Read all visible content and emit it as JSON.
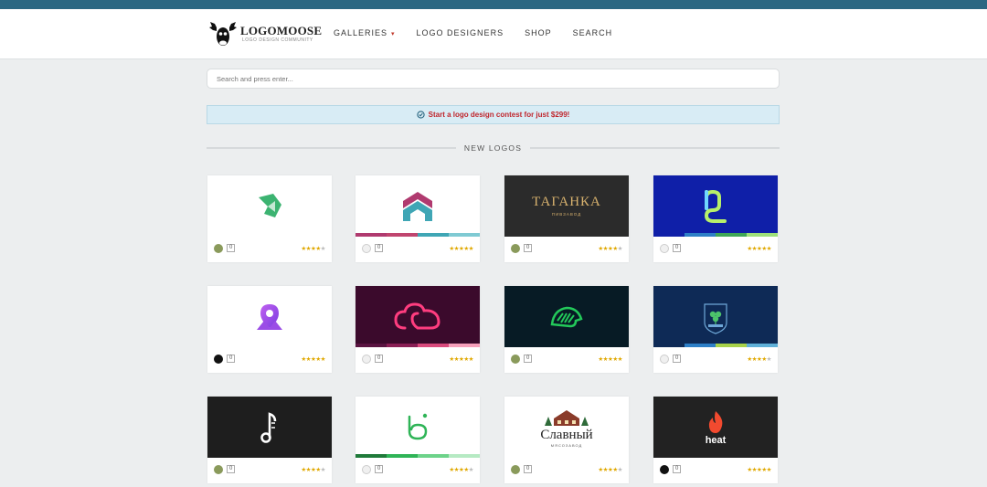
{
  "brand": {
    "name": "LOGOMOOSE",
    "tagline": "LOGO DESIGN COMMUNITY"
  },
  "nav": [
    {
      "label": "GALLERIES",
      "caret": "▾"
    },
    {
      "label": "LOGO DESIGNERS"
    },
    {
      "label": "SHOP"
    },
    {
      "label": "SEARCH"
    }
  ],
  "search": {
    "placeholder": "Search and press enter..."
  },
  "promo": {
    "text": "Start a logo design contest for just $299!"
  },
  "section": {
    "title": "NEW LOGOS"
  },
  "logos": [
    {
      "count": "0",
      "rating": 4,
      "thumb_text": "",
      "thumb_sub": ""
    },
    {
      "count": "0",
      "rating": 5,
      "thumb_text": "",
      "thumb_sub": ""
    },
    {
      "count": "0",
      "rating": 4,
      "thumb_text": "ТАГАНКА",
      "thumb_sub": "ПИВЗАВОД"
    },
    {
      "count": "0",
      "rating": 5,
      "thumb_text": "",
      "thumb_sub": ""
    },
    {
      "count": "0",
      "rating": 5,
      "thumb_text": "",
      "thumb_sub": ""
    },
    {
      "count": "0",
      "rating": 5,
      "thumb_text": "",
      "thumb_sub": ""
    },
    {
      "count": "0",
      "rating": 5,
      "thumb_text": "",
      "thumb_sub": ""
    },
    {
      "count": "0",
      "rating": 4,
      "thumb_text": "",
      "thumb_sub": ""
    },
    {
      "count": "0",
      "rating": 4,
      "thumb_text": "",
      "thumb_sub": ""
    },
    {
      "count": "0",
      "rating": 4,
      "thumb_text": "",
      "thumb_sub": ""
    },
    {
      "count": "0",
      "rating": 4,
      "thumb_text": "Славный",
      "thumb_sub": "МЯСОЗАВОД"
    },
    {
      "count": "0",
      "rating": 5,
      "thumb_text": "heat",
      "thumb_sub": ""
    }
  ],
  "colors": {
    "topbar": "#2a6782",
    "accent_red": "#c0262d",
    "star": "#e0a800"
  }
}
